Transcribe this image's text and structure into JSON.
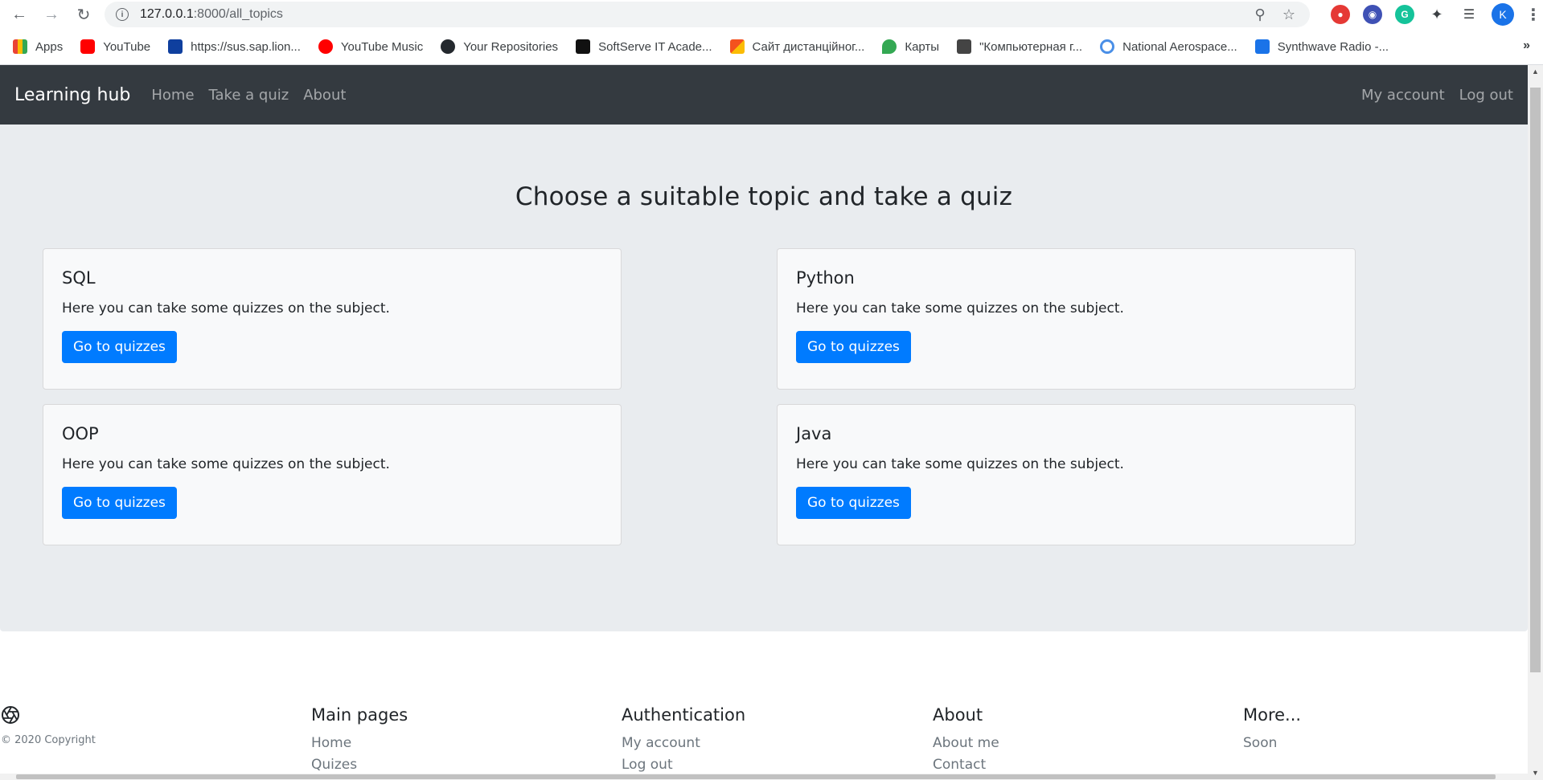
{
  "browser": {
    "url_host": "127.0.0.1",
    "url_path": ":8000/all_topics",
    "profile_initial": "K",
    "bookmarks": [
      {
        "label": "Apps",
        "icon": "apps-grid-icon",
        "color": "#ea4335"
      },
      {
        "label": "YouTube",
        "icon": "youtube-icon",
        "color": "#ff0000"
      },
      {
        "label": "https://sus.sap.lion...",
        "icon": "sap-icon",
        "color": "#0f3f9e"
      },
      {
        "label": "YouTube Music",
        "icon": "youtube-music-icon",
        "color": "#ff0000"
      },
      {
        "label": "Your Repositories",
        "icon": "github-icon",
        "color": "#24292e"
      },
      {
        "label": "SoftServe IT Acade...",
        "icon": "softserve-icon",
        "color": "#111111"
      },
      {
        "label": "Сайт дистанційног...",
        "icon": "site-icon",
        "color": "#f4511e"
      },
      {
        "label": "Карты",
        "icon": "maps-pin-icon",
        "color": "#34a853"
      },
      {
        "label": "\"Компьютерная г...",
        "icon": "id-card-icon",
        "color": "#444444"
      },
      {
        "label": "National Aerospace...",
        "icon": "link-icon",
        "color": "#4a8fe7"
      },
      {
        "label": "Synthwave Radio -...",
        "icon": "radio-icon",
        "color": "#1a73e8"
      }
    ],
    "more": "»"
  },
  "navbar": {
    "brand": "Learning hub",
    "links": [
      "Home",
      "Take a quiz",
      "About"
    ],
    "right_links": [
      "My account",
      "Log out"
    ]
  },
  "main": {
    "heading": "Choose a suitable topic and take a quiz",
    "cards": [
      {
        "title": "SQL",
        "text": "Here you can take some quizzes on the subject.",
        "button": "Go to quizzes"
      },
      {
        "title": "Python",
        "text": "Here you can take some quizzes on the subject.",
        "button": "Go to quizzes"
      },
      {
        "title": "OOP",
        "text": "Here you can take some quizzes on the subject.",
        "button": "Go to quizzes"
      },
      {
        "title": "Java",
        "text": "Here you can take some quizzes on the subject.",
        "button": "Go to quizzes"
      }
    ]
  },
  "footer": {
    "copyright": "© 2020 Copyright",
    "columns": [
      {
        "title": "Main pages",
        "links": [
          "Home",
          "Quizes"
        ]
      },
      {
        "title": "Authentication",
        "links": [
          "My account",
          "Log out"
        ]
      },
      {
        "title": "About",
        "links": [
          "About me",
          "Contact"
        ]
      },
      {
        "title": "More...",
        "links": [
          "Soon"
        ]
      }
    ]
  },
  "colors": {
    "navbar_bg": "#343a40",
    "jumbotron_bg": "#e9ecef",
    "primary": "#007bff",
    "card_bg": "#f8f9fa"
  }
}
